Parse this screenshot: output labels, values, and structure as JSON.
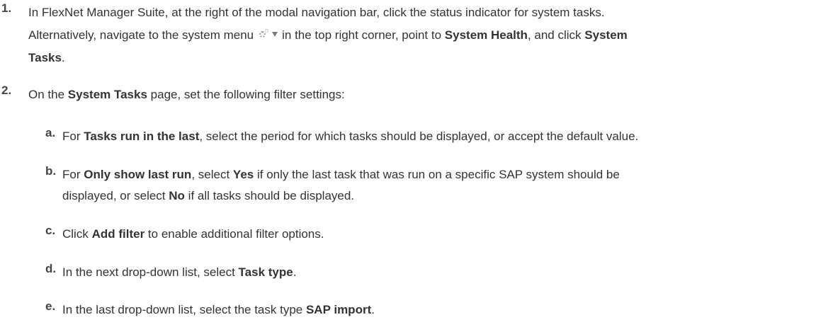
{
  "steps": [
    {
      "number": "1.",
      "l1": "In FlexNet Manager Suite, at the right of the modal navigation bar, click the status indicator for system tasks.",
      "l2a": "Alternatively, navigate to the system menu",
      "l2b": "in the top right corner, point to",
      "l2c": "System Health",
      "l2d": ", and click",
      "l2e": "System",
      "l3a": "Tasks",
      "l3b": "."
    },
    {
      "number": "2.",
      "a": "On the",
      "b": "System Tasks",
      "c": "page, set the following filter settings:"
    }
  ],
  "substeps": [
    {
      "letter": "a.",
      "t1": "For",
      "t2": "Tasks run in the last",
      "t3": ", select the period for which tasks should be displayed, or accept the default value."
    },
    {
      "letter": "b.",
      "t1": "For",
      "t2": "Only show last run",
      "t3": ", select",
      "t4": "Yes",
      "t5": "if only the last task that was run on a specific SAP system should be",
      "t6": "displayed, or select",
      "t7": "No",
      "t8": "if all tasks should be displayed."
    },
    {
      "letter": "c.",
      "t1": "Click",
      "t2": "Add filter",
      "t3": "to enable additional filter options."
    },
    {
      "letter": "d.",
      "t1": "In the next drop-down list, select",
      "t2": "Task type",
      "t3": "."
    },
    {
      "letter": "e.",
      "t1": "In the last drop-down list, select the task type",
      "t2": "SAP import",
      "t3": "."
    }
  ],
  "icons": {
    "system_menu": "gear-dropdown-icon"
  }
}
